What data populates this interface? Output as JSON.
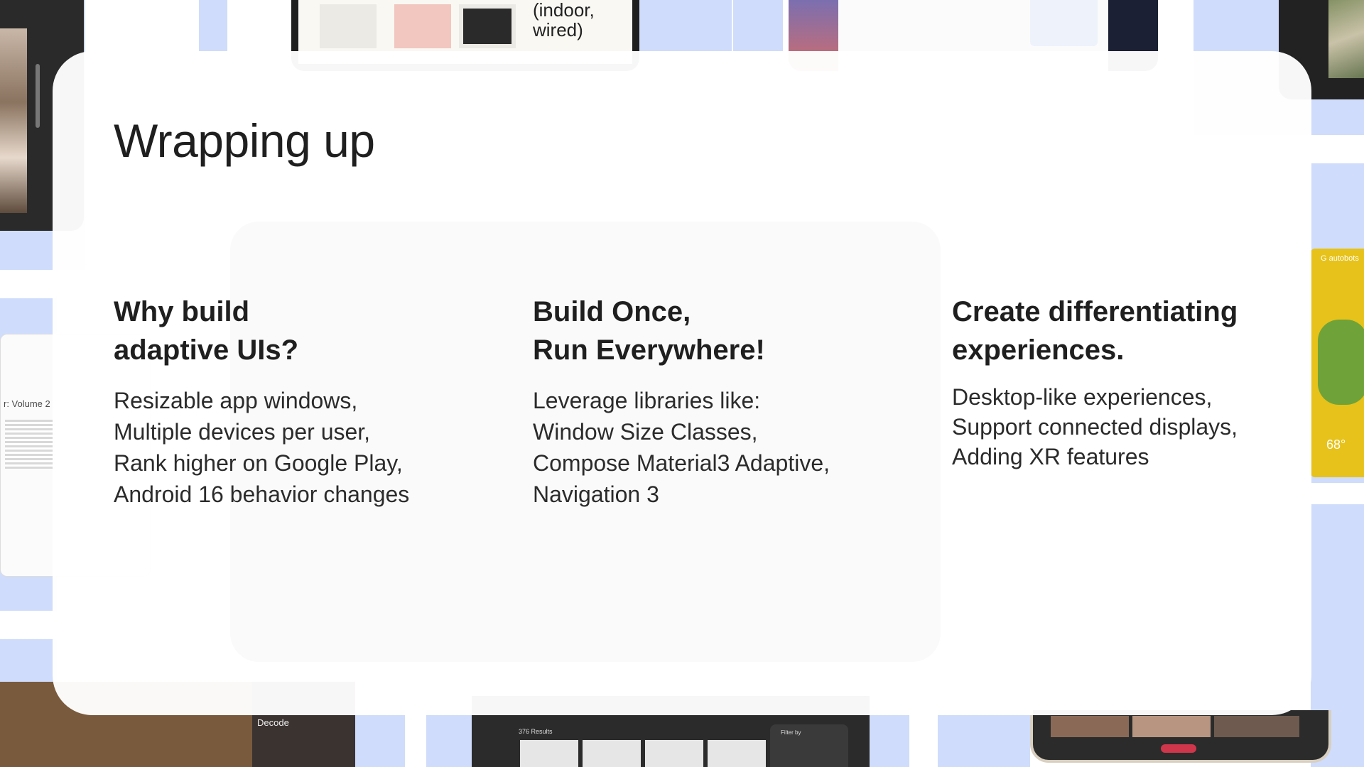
{
  "slide": {
    "title": "Wrapping up",
    "columns": [
      {
        "heading": "Why build\nadaptive UIs?",
        "lines": [
          "Resizable app windows,",
          "Multiple devices per user,",
          "Rank higher on Google Play,",
          "Android 16 behavior changes"
        ]
      },
      {
        "heading": "Build Once,\nRun Everywhere!",
        "lines": [
          "Leverage libraries like:",
          "Window Size Classes,",
          "Compose Material3 Adaptive,",
          "Navigation 3"
        ]
      },
      {
        "heading": "Create differentiating\nexperiences.",
        "lines": [
          "Desktop-like experiences,",
          "Support connected displays,",
          "Adding XR features"
        ]
      }
    ]
  },
  "background": {
    "product_text": "(indoor,\nwired)",
    "book_label": "r: Volume 2",
    "decode_title": "Decode",
    "results_label": "376 Results",
    "filter_label": "Filter by",
    "temperature": "68°",
    "chip_label": "G autobots"
  },
  "colors": {
    "accent_blue": "#cfdcfb",
    "text": "#1f1f1f"
  }
}
